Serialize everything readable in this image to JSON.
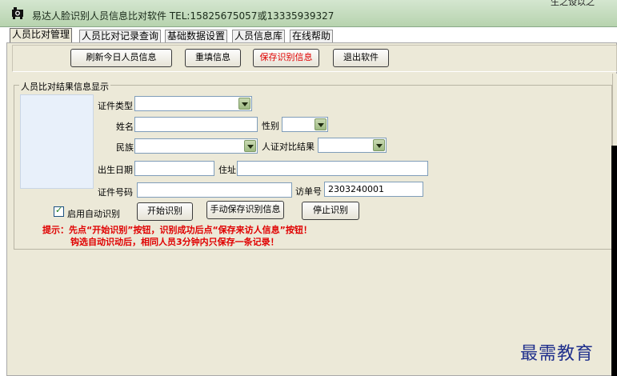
{
  "window": {
    "title": "易达人脸识别人员信息比对软件 TEL:15825675057或13335939327",
    "corner_text": "生之设以之"
  },
  "tabs": [
    {
      "label": "人员比对管理",
      "active": true
    },
    {
      "label": "人员比对记录查询",
      "active": false
    },
    {
      "label": "基础数据设置",
      "active": false
    },
    {
      "label": "人员信息库",
      "active": false
    },
    {
      "label": "在线帮助",
      "active": false
    }
  ],
  "toolbar": {
    "refresh_label": "刷新今日人员信息",
    "refill_label": "重填信息",
    "save_label": "保存识别信息",
    "exit_label": "退出软件"
  },
  "group": {
    "title": "人员比对结果信息显示"
  },
  "form": {
    "id_type_label": "证件类型",
    "id_type_value": "",
    "name_label": "姓名",
    "name_value": "",
    "gender_label": "性别",
    "gender_value": "",
    "ethnicity_label": "民族",
    "ethnicity_value": "",
    "match_result_label": "人证对比结果",
    "match_result_value": "",
    "birthdate_label": "出生日期",
    "birthdate_value": "",
    "address_label": "住址",
    "address_value": "",
    "id_number_label": "证件号码",
    "id_number_value": "",
    "visit_no_label": "访单号",
    "visit_no_value": "2303240001"
  },
  "controls": {
    "auto_recognize_label": "启用自动识别",
    "auto_recognize_checked": true,
    "start_label": "开始识别",
    "manual_save_label": "手动保存识别信息",
    "stop_label": "停止识别"
  },
  "tips": {
    "line1": "提示：先点“开始识别”按钮，识别成功后点“保存来访人信息”按钮！",
    "line2": "钩选自动识动后，相同人员3分钟内只保存一条记录！"
  },
  "watermark": "最需教育",
  "colors": {
    "accent_red": "#e00000",
    "panel_bg": "#ece9d8",
    "title_bg": "#c6dcc0",
    "watermark": "#1f2f8c"
  }
}
